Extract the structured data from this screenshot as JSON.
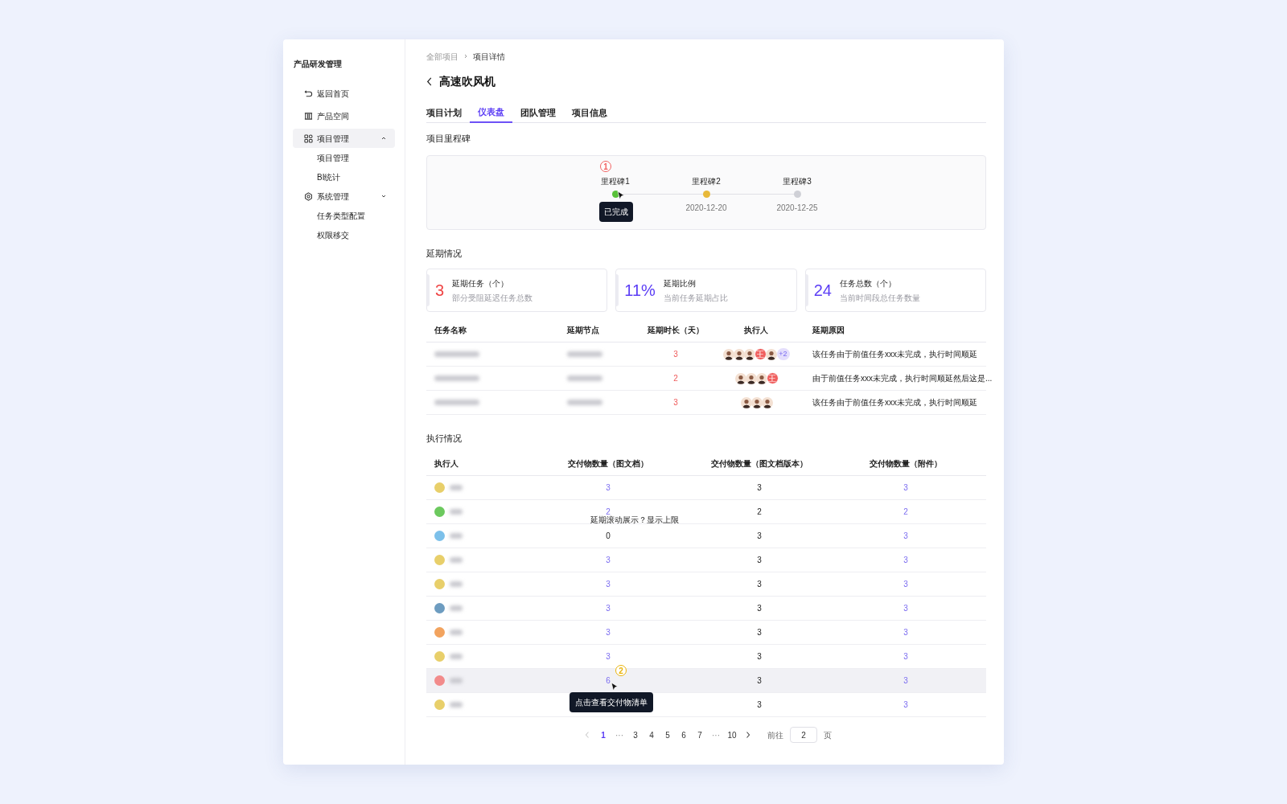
{
  "sidebar": {
    "title": "产品研发管理",
    "items": [
      {
        "label": "返回首页",
        "selected": false
      },
      {
        "label": "产品空间",
        "selected": false
      },
      {
        "label": "项目管理",
        "selected": true,
        "expanded": true,
        "children": [
          {
            "label": "项目管理"
          },
          {
            "label": "BI统计"
          }
        ]
      },
      {
        "label": "系统管理",
        "selected": false,
        "expanded": false,
        "children": [
          {
            "label": "任务类型配置"
          },
          {
            "label": "权限移交"
          }
        ]
      }
    ]
  },
  "breadcrumb": [
    "全部项目",
    "项目详情"
  ],
  "title": "高速吹风机",
  "tabs": [
    {
      "label": "项目计划",
      "selected": false
    },
    {
      "label": "仪表盘",
      "selected": true
    },
    {
      "label": "团队管理",
      "selected": false
    },
    {
      "label": "项目信息",
      "selected": false
    }
  ],
  "milestones": {
    "heading": "项目里程碑",
    "items": [
      {
        "name": "里程碑1",
        "color": "#59c13a",
        "marker": {
          "label": "1",
          "color": "#f06060"
        },
        "tooltip": "已完成"
      },
      {
        "name": "里程碑2",
        "color": "#e8b93a",
        "date": "2020-12-20"
      },
      {
        "name": "里程碑3",
        "color": "#cfd0d6",
        "date": "2020-12-25"
      }
    ]
  },
  "delay": {
    "heading": "延期情况",
    "cards": [
      {
        "figure": "3",
        "title": "延期任务（个）",
        "hint": "部分受阻延迟任务总数",
        "color": "#ef4444"
      },
      {
        "figure": "11%",
        "title": "延期比例",
        "hint": "当前任务延期占比",
        "color": "#5b3df5"
      },
      {
        "figure": "24",
        "title": "任务总数（个）",
        "hint": "当前时间段总任务数量",
        "color": "#5b3df5"
      }
    ],
    "columns": [
      "任务名称",
      "延期节点",
      "延期时长（天）",
      "执行人",
      "延期原因"
    ],
    "rows": [
      {
        "days": "3",
        "avatars": [
          {
            "kind": "person"
          },
          {
            "kind": "person"
          },
          {
            "kind": "person"
          },
          {
            "kind": "initial",
            "text": "王"
          },
          {
            "kind": "person"
          }
        ],
        "more": "+2",
        "reason": "该任务由于前值任务xxx未完成，执行时间顺延"
      },
      {
        "days": "2",
        "avatars": [
          {
            "kind": "person"
          },
          {
            "kind": "person"
          },
          {
            "kind": "person"
          },
          {
            "kind": "initial",
            "text": "王"
          }
        ],
        "reason": "由于前值任务xxx未完成，执行时间顺延然后这是..."
      },
      {
        "days": "3",
        "avatars": [
          {
            "kind": "person"
          },
          {
            "kind": "person"
          },
          {
            "kind": "person"
          }
        ],
        "reason": "该任务由于前值任务xxx未完成，执行时间顺延"
      }
    ]
  },
  "execution": {
    "heading": "执行情况",
    "columns": [
      "执行人",
      "交付物数量（图文档）",
      "交付物数量（图文档版本）",
      "交付物数量（附件）"
    ],
    "rows": [
      {
        "color": "#e8cf6a",
        "highlighted": false,
        "docs": "3",
        "docs_link": true,
        "versions": "3",
        "attachments": "3"
      },
      {
        "color": "#6cc95e",
        "highlighted": false,
        "docs": "2",
        "docs_link": true,
        "versions": "2",
        "attachments": "2",
        "note": "延期滚动展示？显示上限"
      },
      {
        "color": "#7cc0ea",
        "highlighted": false,
        "docs": "0",
        "docs_link": false,
        "versions": "3",
        "attachments": "3"
      },
      {
        "color": "#e8cf6a",
        "highlighted": false,
        "docs": "3",
        "docs_link": true,
        "versions": "3",
        "attachments": "3"
      },
      {
        "color": "#e8cf6a",
        "highlighted": false,
        "docs": "3",
        "docs_link": true,
        "versions": "3",
        "attachments": "3"
      },
      {
        "color": "#6d9cc0",
        "highlighted": false,
        "docs": "3",
        "docs_link": true,
        "versions": "3",
        "attachments": "3"
      },
      {
        "color": "#f2a35e",
        "highlighted": false,
        "docs": "3",
        "docs_link": true,
        "versions": "3",
        "attachments": "3"
      },
      {
        "color": "#e8cf6a",
        "highlighted": false,
        "docs": "3",
        "docs_link": true,
        "versions": "3",
        "attachments": "3"
      },
      {
        "color": "#f28b8b",
        "highlighted": true,
        "docs": "6",
        "docs_link": true,
        "versions": "3",
        "attachments": "3",
        "marker": {
          "label": "2",
          "color": "#eab308"
        },
        "tooltip": "点击查看交付物清单"
      },
      {
        "color": "#e8cf6a",
        "highlighted": false,
        "versions": "3",
        "attachments": "3"
      }
    ]
  },
  "pagination": {
    "prev_disabled": true,
    "pages": [
      {
        "kind": "page",
        "label": "1",
        "selected": true
      },
      {
        "kind": "ellipsis",
        "label": "···"
      },
      {
        "kind": "page",
        "label": "3",
        "selected": false
      },
      {
        "kind": "page",
        "label": "4",
        "selected": false
      },
      {
        "kind": "page",
        "label": "5",
        "selected": false
      },
      {
        "kind": "page",
        "label": "6",
        "selected": false
      },
      {
        "kind": "page",
        "label": "7",
        "selected": false
      },
      {
        "kind": "ellipsis",
        "label": "···"
      },
      {
        "kind": "page",
        "label": "10",
        "selected": false
      }
    ],
    "goto_label": "前往",
    "goto_value": "2",
    "goto_suffix": "页"
  }
}
